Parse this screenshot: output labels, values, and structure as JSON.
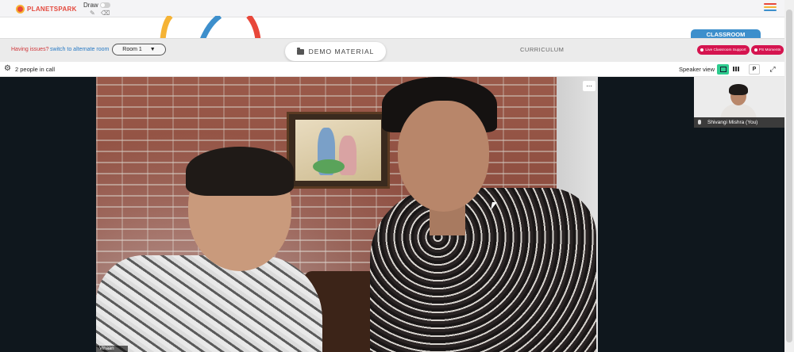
{
  "topbar": {
    "brand": "PLANETSPARK",
    "draw_label": "Draw",
    "draw_enabled": false,
    "menu_colors": [
      "#e8473a",
      "#f5b335",
      "#3d8fcc"
    ]
  },
  "header": {
    "issue_text": "Having issues?",
    "switch_link": "switch to alternate room",
    "room": "Room 1",
    "room_caret": "▼",
    "demo_material": "DEMO MATERIAL",
    "curriculum": "CURRICULUM",
    "classroom_tab": "CLASSROOM",
    "live_support": "Live Classroom Support",
    "ps_moments": "PS Moments"
  },
  "callbar": {
    "people_in_call": "2 people in call",
    "view_mode": "Speaker view",
    "p_button": "P"
  },
  "video": {
    "more_options": "...",
    "participant_label": "Vihaan",
    "self_name": "Shivangi Mishra (You)"
  },
  "icons": {
    "gear": "⚙",
    "expand": "⤢",
    "pencil": "✎",
    "eraser": "⌫"
  }
}
